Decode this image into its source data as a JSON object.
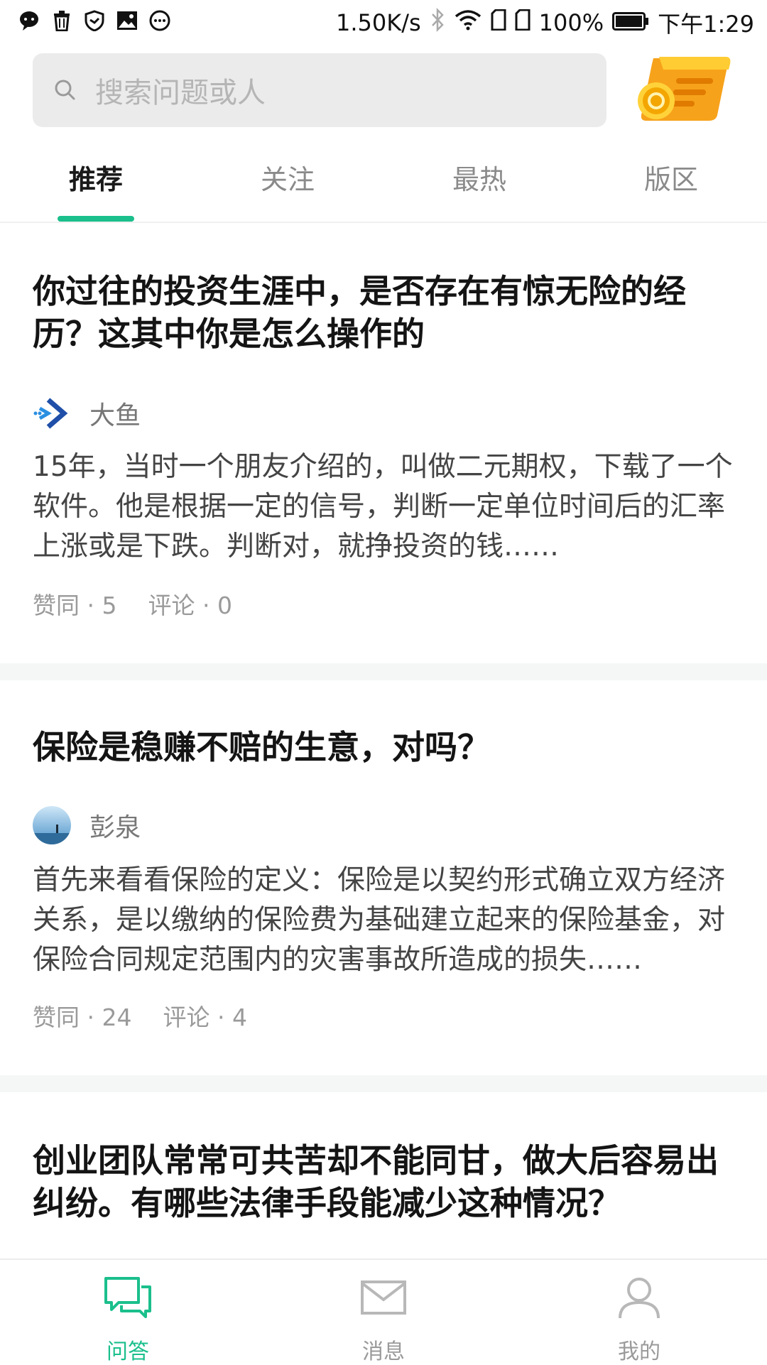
{
  "status_bar": {
    "net_speed": "1.50K/s",
    "battery": "100%",
    "time": "下午1:29"
  },
  "search": {
    "placeholder": "搜索问题或人"
  },
  "tabs": [
    {
      "label": "推荐",
      "active": true
    },
    {
      "label": "关注",
      "active": false
    },
    {
      "label": "最热",
      "active": false
    },
    {
      "label": "版区",
      "active": false
    }
  ],
  "feed": [
    {
      "title": "你过往的投资生涯中，是否存在有惊无险的经历？这其中你是怎么操作的",
      "author": "大鱼",
      "excerpt": "15年，当时一个朋友介绍的，叫做二元期权，下载了一个软件。他是根据一定的信号，判断一定单位时间后的汇率上涨或是下跌。判断对，就挣投资的钱……",
      "likes": "赞同 · 5",
      "comments": "评论 · 0"
    },
    {
      "title": "保险是稳赚不赔的生意，对吗？",
      "author": "彭泉",
      "excerpt": "首先来看看保险的定义：保险是以契约形式确立双方经济关系，是以缴纳的保险费为基础建立起来的保险基金，对保险合同规定范围内的灾害事故所造成的损失……",
      "likes": "赞同 · 24",
      "comments": "评论 · 4"
    },
    {
      "title": "创业团队常常可共苦却不能同甘，做大后容易出纠纷。有哪些法律手段能减少这种情况？"
    }
  ],
  "bottom_nav": [
    {
      "label": "问答",
      "icon": "chat-bubbles-icon",
      "active": true
    },
    {
      "label": "消息",
      "icon": "envelope-icon",
      "active": false
    },
    {
      "label": "我的",
      "icon": "person-icon",
      "active": false
    }
  ],
  "colors": {
    "accent": "#1bbf8c",
    "text_primary": "#141414",
    "text_secondary": "#777777"
  }
}
